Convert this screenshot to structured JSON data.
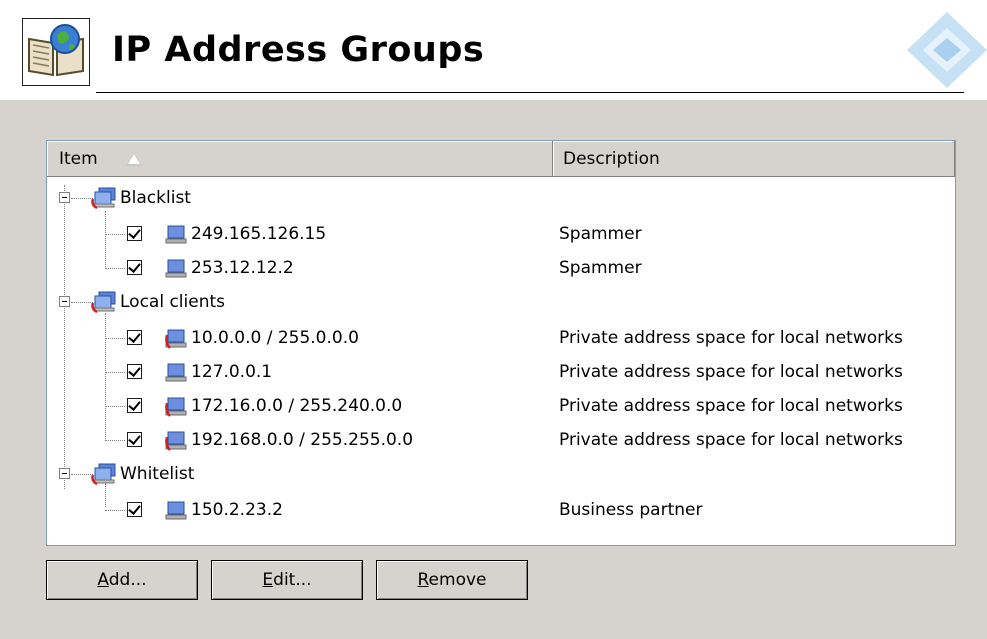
{
  "header": {
    "title": "IP Address Groups"
  },
  "columns": {
    "item": "Item",
    "description": "Description"
  },
  "groups": [
    {
      "label": "Blacklist",
      "items": [
        {
          "ip": "249.165.126.15",
          "desc": "Spammer"
        },
        {
          "ip": "253.12.12.2",
          "desc": "Spammer"
        }
      ]
    },
    {
      "label": "Local clients",
      "items": [
        {
          "ip": "10.0.0.0 / 255.0.0.0",
          "desc": "Private address space for local networks"
        },
        {
          "ip": "127.0.0.1",
          "desc": "Private address space for local networks"
        },
        {
          "ip": "172.16.0.0 / 255.240.0.0",
          "desc": "Private address space for local networks"
        },
        {
          "ip": "192.168.0.0 / 255.255.0.0",
          "desc": "Private address space for local networks"
        }
      ]
    },
    {
      "label": "Whitelist",
      "items": [
        {
          "ip": "150.2.23.2",
          "desc": "Business partner"
        }
      ]
    }
  ],
  "buttons": {
    "add": {
      "mnemonic": "A",
      "rest": "dd..."
    },
    "edit": {
      "mnemonic": "E",
      "rest": "dit..."
    },
    "remove": {
      "mnemonic": "R",
      "rest": "emove"
    }
  }
}
